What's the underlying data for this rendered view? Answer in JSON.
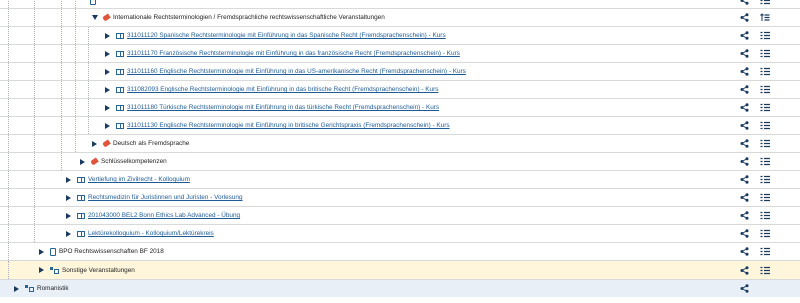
{
  "rows": [
    {
      "label": "",
      "kind": "doc",
      "link": false,
      "level": 3,
      "toggle": "none",
      "hl": "",
      "share": true,
      "list": true
    },
    {
      "label": "Internationale Rechtsterminologien / Fremdsprachliche rechtswissenschaftliche Veranstaltungen",
      "kind": "tag",
      "link": false,
      "level": 3,
      "toggle": "down",
      "hl": "",
      "share": true,
      "list": true,
      "list_variant": "sort"
    },
    {
      "label": "311011120 Spanische Rechtsterminologie mit Einführung in das Spanische Recht (Fremdsprachenschein) - Kurs",
      "kind": "book",
      "link": true,
      "level": 4,
      "toggle": "right",
      "hl": "",
      "share": true,
      "list": true
    },
    {
      "label": "311011170 Französische Rechtsterminologie mit Einführung in das französische Recht (Fremdsprachenschein) - Kurs",
      "kind": "book",
      "link": true,
      "level": 4,
      "toggle": "right",
      "hl": "",
      "share": true,
      "list": true
    },
    {
      "label": "311011160 Englische Rechtsterminologie mit Einführung in das US-amerikanische Recht (Fremdsprachenschein) - Kurs",
      "kind": "book",
      "link": true,
      "level": 4,
      "toggle": "right",
      "hl": "",
      "share": true,
      "list": true
    },
    {
      "label": "311082093 Englische Rechtsterminologie mit Einführung in das britische Recht (Fremdsprachenschein) - Kurs",
      "kind": "book",
      "link": true,
      "level": 4,
      "toggle": "right",
      "hl": "",
      "share": true,
      "list": true
    },
    {
      "label": "311011180 Türkische Rechtsterminologie mit Einführung in das türkische Recht (Fremdsprachenschein) - Kurs",
      "kind": "book",
      "link": true,
      "level": 4,
      "toggle": "right",
      "hl": "",
      "share": true,
      "list": true
    },
    {
      "label": "311011130 Englische Rechtsterminologie mit Einführung in britische Gerichtspraxis (Fremdsprachenschein) - Kurs",
      "kind": "book",
      "link": true,
      "level": 4,
      "toggle": "right",
      "hl": "",
      "share": true,
      "list": true
    },
    {
      "label": "Deutsch als Fremdsprache",
      "kind": "tag",
      "link": false,
      "level": 3,
      "toggle": "right",
      "hl": "",
      "share": true,
      "list": true
    },
    {
      "label": "Schlüsselkompetenzen",
      "kind": "tag",
      "link": false,
      "level": 2,
      "toggle": "right",
      "hl": "",
      "share": true,
      "list": true
    },
    {
      "label": "Vertiefung im Zivilrecht - Kolloquium",
      "kind": "book",
      "link": true,
      "level": 1,
      "toggle": "right",
      "hl": "",
      "share": true,
      "list": true
    },
    {
      "label": "Rechtsmedizin für Juristinnen und Juristen - Vorlesung",
      "kind": "book",
      "link": true,
      "level": 1,
      "toggle": "right",
      "hl": "",
      "share": true,
      "list": true
    },
    {
      "label": "201043000 BEL2 Bonn Ethics Lab Advanced - Übung",
      "kind": "book",
      "link": true,
      "level": 1,
      "toggle": "right",
      "hl": "",
      "share": true,
      "list": true
    },
    {
      "label": "Lektürekolloquium - Kolloquium/Lektürekreis",
      "kind": "book",
      "link": true,
      "level": 1,
      "toggle": "right",
      "hl": "",
      "share": true,
      "list": true
    },
    {
      "label": "BPO Rechtswissenschaften BF 2018",
      "kind": "doc",
      "link": false,
      "level": 0,
      "toggle": "right",
      "hl": "",
      "share": true,
      "list": true
    },
    {
      "label": "Sonstige Veranstaltungen",
      "kind": "mod",
      "link": false,
      "level": 0,
      "toggle": "right",
      "hl": "yellow",
      "share": true,
      "list": true
    },
    {
      "label": "Romanistik",
      "kind": "mod",
      "link": false,
      "level": -1,
      "toggle": "right",
      "hl": "blue",
      "share": true,
      "list": false
    }
  ],
  "colors": {
    "accent": "#1a3a5e",
    "link": "#1e5b96",
    "highlight": "#fff6dc",
    "highlight_alt": "#e9eff6"
  }
}
